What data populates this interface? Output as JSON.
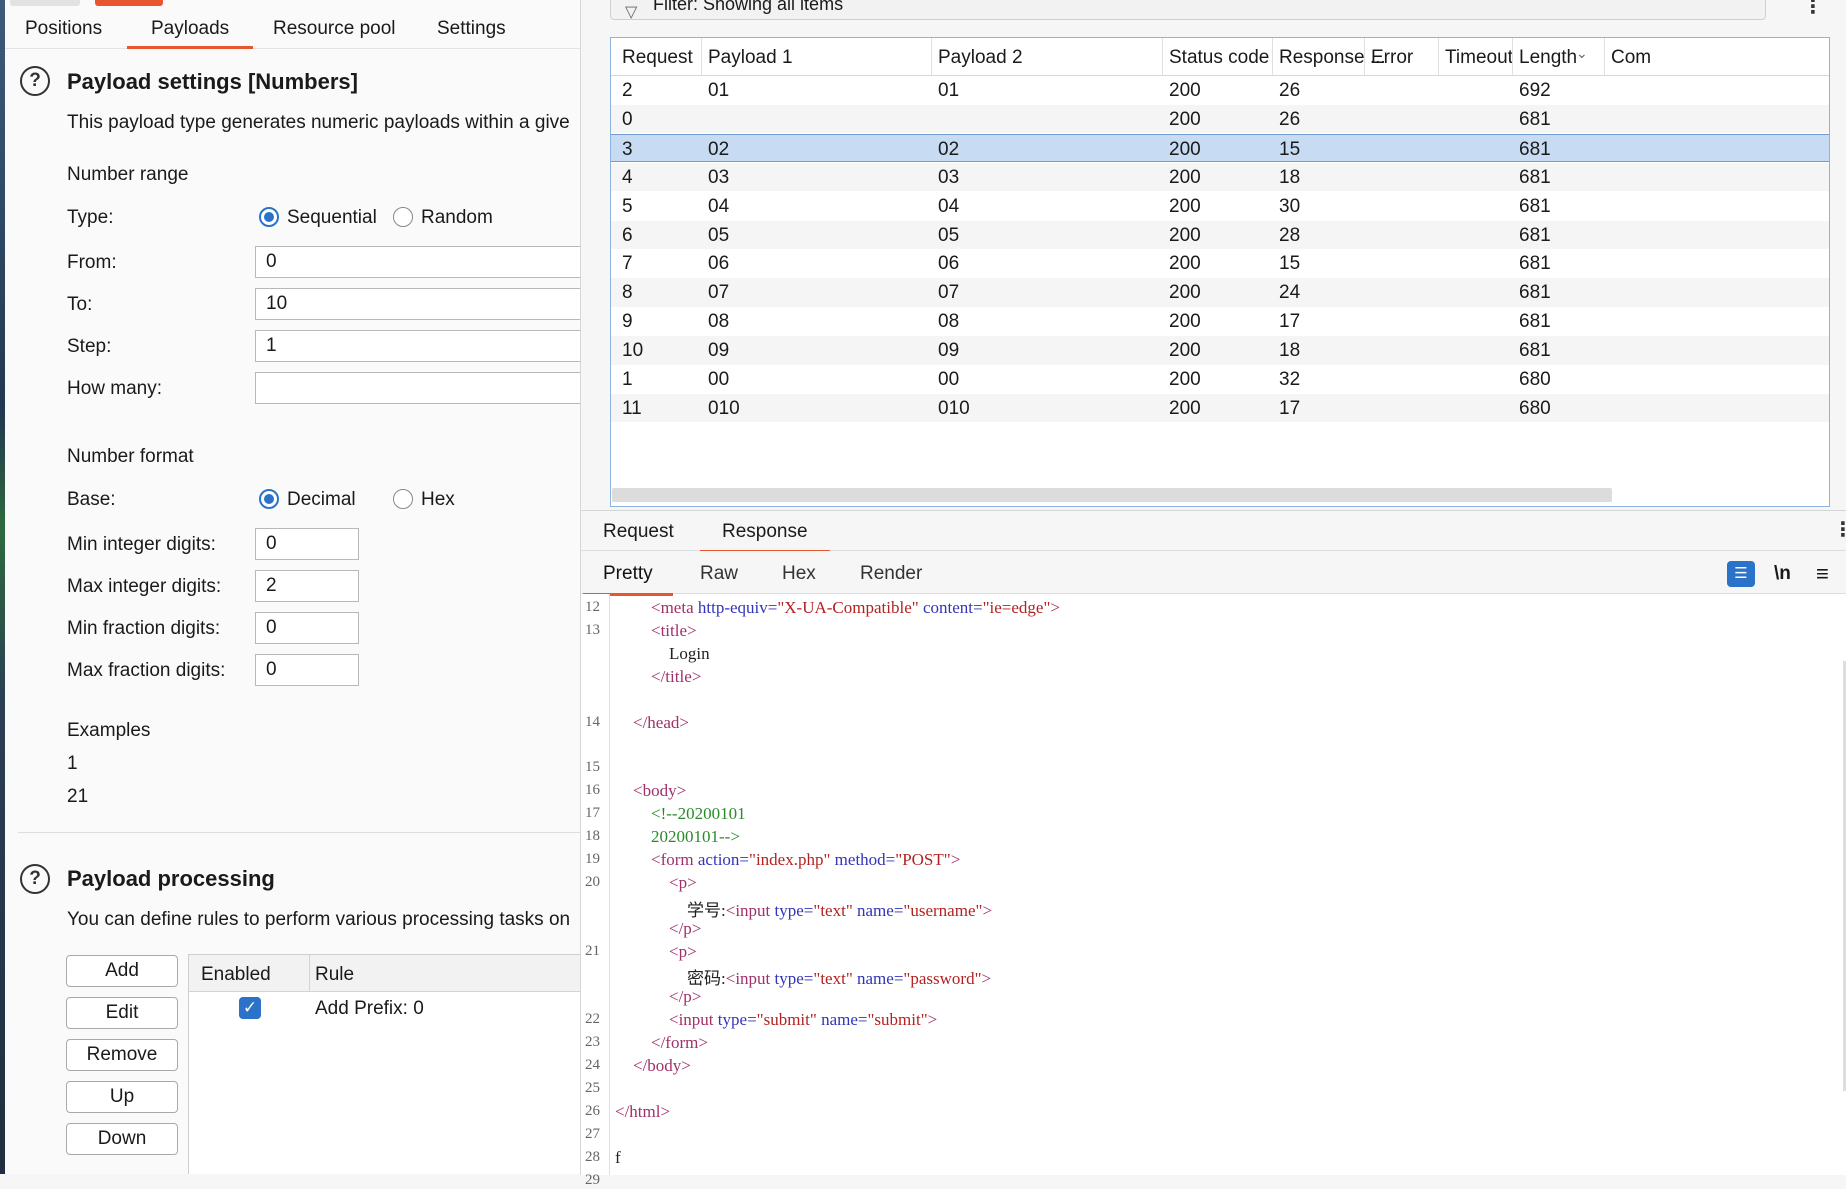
{
  "left": {
    "tabs": [
      "Positions",
      "Payloads",
      "Resource pool",
      "Settings"
    ],
    "active_tab": "Payloads",
    "payload_settings": {
      "title": "Payload settings [Numbers]",
      "description": "This payload type generates numeric payloads within a give",
      "number_range_label": "Number range",
      "type_label": "Type:",
      "type_options": [
        "Sequential",
        "Random"
      ],
      "type_selected": "Sequential",
      "from_label": "From:",
      "from_value": "0",
      "to_label": "To:",
      "to_value": "10",
      "step_label": "Step:",
      "step_value": "1",
      "how_many_label": "How many:",
      "how_many_value": "",
      "number_format_label": "Number format",
      "base_label": "Base:",
      "base_options": [
        "Decimal",
        "Hex"
      ],
      "base_selected": "Decimal",
      "min_int_label": "Min integer digits:",
      "min_int_value": "0",
      "max_int_label": "Max integer digits:",
      "max_int_value": "2",
      "min_frac_label": "Min fraction digits:",
      "min_frac_value": "0",
      "max_frac_label": "Max fraction digits:",
      "max_frac_value": "0",
      "examples_label": "Examples",
      "examples": [
        "1",
        "21"
      ]
    },
    "payload_processing": {
      "title": "Payload processing",
      "description": "You can define rules to perform various processing tasks on",
      "buttons": [
        "Add",
        "Edit",
        "Remove",
        "Up",
        "Down"
      ],
      "columns": [
        "Enabled",
        "Rule"
      ],
      "rules": [
        {
          "enabled": true,
          "rule": "Add Prefix: 0"
        }
      ]
    }
  },
  "results": {
    "filter_text": "Filter: Showing all items",
    "columns": [
      "Request",
      "Payload 1",
      "Payload 2",
      "Status code",
      "Response ...",
      "Error",
      "Timeout",
      "Length",
      "Com"
    ],
    "rows": [
      [
        "2",
        "01",
        "01",
        "200",
        "26",
        "",
        "",
        "692"
      ],
      [
        "0",
        "",
        "",
        "200",
        "26",
        "",
        "",
        "681"
      ],
      [
        "3",
        "02",
        "02",
        "200",
        "15",
        "",
        "",
        "681"
      ],
      [
        "4",
        "03",
        "03",
        "200",
        "18",
        "",
        "",
        "681"
      ],
      [
        "5",
        "04",
        "04",
        "200",
        "30",
        "",
        "",
        "681"
      ],
      [
        "6",
        "05",
        "05",
        "200",
        "28",
        "",
        "",
        "681"
      ],
      [
        "7",
        "06",
        "06",
        "200",
        "15",
        "",
        "",
        "681"
      ],
      [
        "8",
        "07",
        "07",
        "200",
        "24",
        "",
        "",
        "681"
      ],
      [
        "9",
        "08",
        "08",
        "200",
        "17",
        "",
        "",
        "681"
      ],
      [
        "10",
        "09",
        "09",
        "200",
        "18",
        "",
        "",
        "681"
      ],
      [
        "1",
        "00",
        "00",
        "200",
        "32",
        "",
        "",
        "680"
      ],
      [
        "11",
        "010",
        "010",
        "200",
        "17",
        "",
        "",
        "680"
      ]
    ],
    "selected_row": 2
  },
  "viewer": {
    "tabs": [
      "Request",
      "Response"
    ],
    "active_tab": "Response",
    "view_tabs": [
      "Pretty",
      "Raw",
      "Hex",
      "Render"
    ],
    "active_view": "Pretty",
    "newline_toggle": "\\n"
  },
  "code_lines": [
    {
      "n": "12",
      "indent": 2,
      "parts": [
        [
          "tag",
          "<meta "
        ],
        [
          "attr",
          "http-equiv="
        ],
        [
          "val",
          "\"X-UA-Compatible\""
        ],
        [
          "plain",
          " "
        ],
        [
          "attr",
          "content="
        ],
        [
          "val",
          "\"ie=edge\""
        ],
        [
          "tag",
          ">"
        ]
      ]
    },
    {
      "n": "13",
      "indent": 2,
      "parts": [
        [
          "tag",
          "<title>"
        ]
      ]
    },
    {
      "n": "",
      "indent": 3,
      "parts": [
        [
          "plain",
          "Login"
        ]
      ]
    },
    {
      "n": "",
      "indent": 2,
      "parts": [
        [
          "tag",
          "</title>"
        ]
      ]
    },
    {
      "n": "",
      "indent": 0,
      "parts": []
    },
    {
      "n": "14",
      "indent": 1,
      "parts": [
        [
          "tag",
          "</head>"
        ]
      ]
    },
    {
      "n": "",
      "indent": 0,
      "parts": []
    },
    {
      "n": "15",
      "indent": 0,
      "parts": []
    },
    {
      "n": "16",
      "indent": 1,
      "parts": [
        [
          "tag",
          "<body>"
        ]
      ]
    },
    {
      "n": "17",
      "indent": 2,
      "parts": [
        [
          "cmt",
          "<!--20200101"
        ]
      ]
    },
    {
      "n": "18",
      "indent": 2,
      "parts": [
        [
          "cmt",
          "20200101-->"
        ]
      ]
    },
    {
      "n": "19",
      "indent": 2,
      "parts": [
        [
          "tag",
          "<form "
        ],
        [
          "attr",
          "action="
        ],
        [
          "val",
          "\"index.php\""
        ],
        [
          "plain",
          " "
        ],
        [
          "attr",
          "method="
        ],
        [
          "val",
          "\"POST\""
        ],
        [
          "tag",
          ">"
        ]
      ]
    },
    {
      "n": "20",
      "indent": 3,
      "parts": [
        [
          "tag",
          "<p>"
        ]
      ]
    },
    {
      "n": "",
      "indent": 4,
      "parts": [
        [
          "plain",
          "学号:"
        ],
        [
          "tag",
          "<input "
        ],
        [
          "attr",
          "type="
        ],
        [
          "val",
          "\"text\""
        ],
        [
          "plain",
          " "
        ],
        [
          "attr",
          "name="
        ],
        [
          "val",
          "\"username\""
        ],
        [
          "tag",
          ">"
        ]
      ]
    },
    {
      "n": "",
      "indent": 3,
      "parts": [
        [
          "tag",
          "</p>"
        ]
      ]
    },
    {
      "n": "21",
      "indent": 3,
      "parts": [
        [
          "tag",
          "<p>"
        ]
      ]
    },
    {
      "n": "",
      "indent": 4,
      "parts": [
        [
          "plain",
          "密码:"
        ],
        [
          "tag",
          "<input "
        ],
        [
          "attr",
          "type="
        ],
        [
          "val",
          "\"text\""
        ],
        [
          "plain",
          " "
        ],
        [
          "attr",
          "name="
        ],
        [
          "val",
          "\"password\""
        ],
        [
          "tag",
          ">"
        ]
      ]
    },
    {
      "n": "",
      "indent": 3,
      "parts": [
        [
          "tag",
          "</p>"
        ]
      ]
    },
    {
      "n": "22",
      "indent": 3,
      "parts": [
        [
          "tag",
          "<input "
        ],
        [
          "attr",
          "type="
        ],
        [
          "val",
          "\"submit\""
        ],
        [
          "plain",
          " "
        ],
        [
          "attr",
          "name="
        ],
        [
          "val",
          "\"submit\""
        ],
        [
          "tag",
          ">"
        ]
      ]
    },
    {
      "n": "23",
      "indent": 2,
      "parts": [
        [
          "tag",
          "</form>"
        ]
      ]
    },
    {
      "n": "24",
      "indent": 1,
      "parts": [
        [
          "tag",
          "</body>"
        ]
      ]
    },
    {
      "n": "25",
      "indent": 0,
      "parts": []
    },
    {
      "n": "26",
      "indent": 0,
      "parts": [
        [
          "tag",
          "</html>"
        ]
      ]
    },
    {
      "n": "27",
      "indent": 0,
      "parts": []
    },
    {
      "n": "28",
      "indent": 0,
      "parts": [
        [
          "plain",
          "f"
        ]
      ]
    },
    {
      "n": "29",
      "indent": 0,
      "parts": []
    }
  ],
  "icons": {
    "help": "help-circle-icon",
    "filter": "filter-icon",
    "kebab": "more-vertical-icon",
    "wrap": "word-wrap-icon",
    "menu": "hamburger-menu-icon",
    "check": "checkmark-icon"
  },
  "colors": {
    "accent": "#e8562f",
    "selection": "#c7dbf2",
    "primary_blue": "#2b73c8"
  }
}
